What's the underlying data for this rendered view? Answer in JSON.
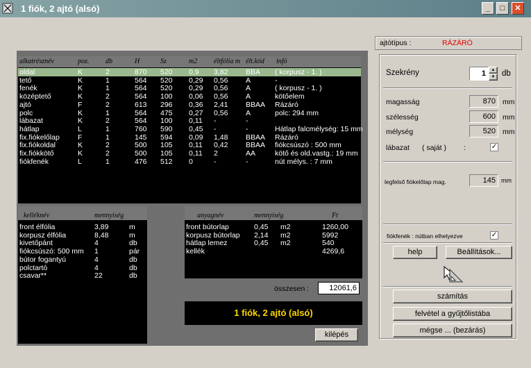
{
  "window": {
    "title": "1 fiók, 2 ajtó (alsó)"
  },
  "parts": {
    "headers": [
      "alkatrésznév",
      "poz.",
      "db",
      "H",
      "Sz",
      "m2",
      "éltfólia m",
      "élt.kód",
      "infó"
    ],
    "rows": [
      [
        "oldal",
        "K",
        "2",
        "870",
        "520",
        "0,9",
        "3,82",
        "BBA",
        "( korpusz - 1. )"
      ],
      [
        "tető",
        "K",
        "1",
        "564",
        "520",
        "0,29",
        "0,56",
        "A",
        "-"
      ],
      [
        "fenék",
        "K",
        "1",
        "564",
        "520",
        "0,29",
        "0,56",
        "A",
        "( korpusz - 1. )"
      ],
      [
        "középtető",
        "K",
        "2",
        "564",
        "100",
        "0,06",
        "0,56",
        "A",
        "kötőelem"
      ],
      [
        "ajtó",
        "F",
        "2",
        "613",
        "296",
        "0,36",
        "2,41",
        "BBAA",
        "Rázáró"
      ],
      [
        "polc",
        "K",
        "1",
        "564",
        "475",
        "0,27",
        "0,56",
        "A",
        "polc:  294  mm"
      ],
      [
        "lábazat",
        "K",
        "2",
        "564",
        "100",
        "0,11",
        "-",
        "-",
        ""
      ],
      [
        "hátlap",
        "L",
        "1",
        "760",
        "590",
        "0,45",
        "-",
        "-",
        "Hátlap falcmélység: 15 mm"
      ],
      [
        "fix.fiókelőlap",
        "F",
        "1",
        "145",
        "594",
        "0,09",
        "1,48",
        "BBAA",
        "Rázáró"
      ],
      [
        "fix.fiókoldal",
        "K",
        "2",
        "500",
        "105",
        "0,11",
        "0,42",
        "BBAA",
        "fiókcsúszó  :  500 mm"
      ],
      [
        "fix.fiókkötő",
        "K",
        "2",
        "500",
        "105",
        "0,11",
        "2",
        "AA",
        "kötő és old.vastg.: 19  mm"
      ],
      [
        "fiókfenék",
        "L",
        "1",
        "476",
        "512",
        "0",
        "-",
        "-",
        "nút mélys.   :  7 mm"
      ]
    ]
  },
  "fittings": {
    "headers": [
      "kelléknév",
      "mennyiség"
    ],
    "rows": [
      [
        "front élfólia",
        "3,89",
        "m"
      ],
      [
        "korpusz élfólia",
        "8,48",
        "m"
      ],
      [
        "kivetőpánt",
        "4",
        "db"
      ],
      [
        "fiókcsúszó: 500 mm",
        "1",
        "pár"
      ],
      [
        "bútor fogantyú",
        "4",
        "db"
      ],
      [
        "polctartó",
        "4",
        "db"
      ],
      [
        "csavar**",
        "22",
        "db"
      ]
    ]
  },
  "materials": {
    "headers": [
      "anyagnév",
      "mennyiség",
      "Ft"
    ],
    "rows": [
      [
        "front bútorlap",
        "0,45",
        "m2",
        "1260,00"
      ],
      [
        "korpusz bútorlap",
        "2,14",
        "m2",
        "5992"
      ],
      [
        "hátlap lemez",
        "0,45",
        "m2",
        "540"
      ],
      [
        "kellék",
        "",
        "",
        "4269,6"
      ]
    ],
    "total_label": "összesen :",
    "total_value": "12061,6"
  },
  "banner": "1 fiók, 2 ajtó (alsó)",
  "exit_label": "kilépés",
  "right": {
    "door_type_label": "ajtótípus :",
    "door_type_value": "RÁZÁRÓ",
    "cabinet_label": "Szekrény",
    "cabinet_value": "1",
    "cabinet_unit": "db",
    "height_label": "magasság",
    "height_value": "870",
    "width_label": "szélesség",
    "width_value": "600",
    "depth_label": "mélység",
    "depth_value": "520",
    "unit": "mm",
    "plinth_label": "lábazat",
    "plinth_own": "( saját )",
    "plinth_colon": ":",
    "top_drawer_label": "legfelső fiókelőlap mag.",
    "top_drawer_value": "145",
    "groove_label": "fiókfenék : nútban elhelyezve",
    "check_mark": "✓",
    "help_label": "help",
    "settings_label": "Beállítások...",
    "calc_label": "számítás",
    "add_label": "felvétel a gyűjtőlistába",
    "cancel_label": "mégse ... (bezárás)"
  }
}
